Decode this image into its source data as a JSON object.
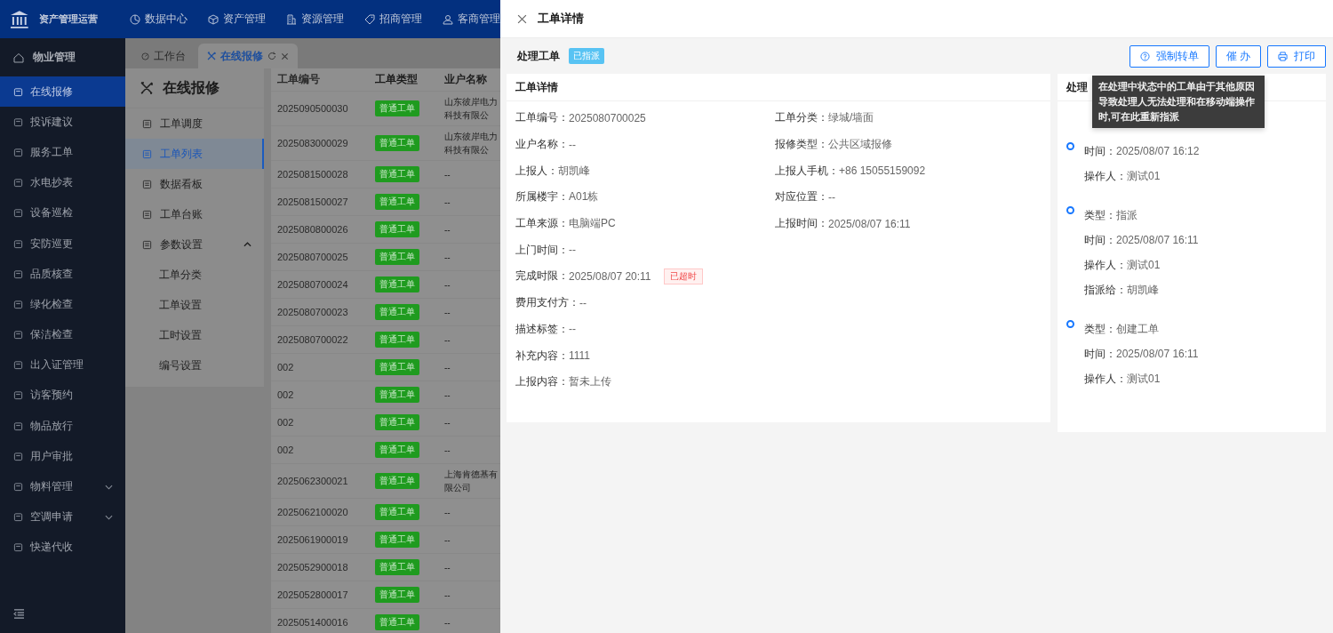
{
  "app": {
    "title": "资产管理运营"
  },
  "top_nav": [
    {
      "label": "数据中心"
    },
    {
      "label": "资产管理"
    },
    {
      "label": "资源管理"
    },
    {
      "label": "招商管理"
    },
    {
      "label": "客商管理"
    }
  ],
  "sidebar": {
    "header": "物业管理",
    "items": [
      {
        "label": "在线报修",
        "selected": true,
        "expandable": false
      },
      {
        "label": "投诉建议",
        "selected": false,
        "expandable": false
      },
      {
        "label": "服务工单",
        "selected": false,
        "expandable": false
      },
      {
        "label": "水电抄表",
        "selected": false,
        "expandable": false
      },
      {
        "label": "设备巡检",
        "selected": false,
        "expandable": false
      },
      {
        "label": "安防巡更",
        "selected": false,
        "expandable": false
      },
      {
        "label": "品质核查",
        "selected": false,
        "expandable": false
      },
      {
        "label": "绿化检查",
        "selected": false,
        "expandable": false
      },
      {
        "label": "保洁检查",
        "selected": false,
        "expandable": false
      },
      {
        "label": "出入证管理",
        "selected": false,
        "expandable": false
      },
      {
        "label": "访客预约",
        "selected": false,
        "expandable": false
      },
      {
        "label": "物品放行",
        "selected": false,
        "expandable": false
      },
      {
        "label": "用户审批",
        "selected": false,
        "expandable": false
      },
      {
        "label": "物料管理",
        "selected": false,
        "expandable": true
      },
      {
        "label": "空调申请",
        "selected": false,
        "expandable": true
      },
      {
        "label": "快递代收",
        "selected": false,
        "expandable": false
      }
    ]
  },
  "tabs": [
    {
      "label": "工作台",
      "selected": false
    },
    {
      "label": "在线报修",
      "selected": true
    }
  ],
  "submenu": {
    "title": "在线报修",
    "items": [
      {
        "label": "工单调度",
        "selected": false
      },
      {
        "label": "工单列表",
        "selected": true
      },
      {
        "label": "数据看板",
        "selected": false
      },
      {
        "label": "工单台账",
        "selected": false
      },
      {
        "label": "参数设置",
        "selected": false,
        "expanded": true,
        "children": [
          {
            "label": "工单分类"
          },
          {
            "label": "工单设置"
          },
          {
            "label": "工时设置"
          },
          {
            "label": "编号设置"
          }
        ]
      }
    ]
  },
  "table": {
    "columns": [
      "工单编号",
      "工单类型",
      "业户名称"
    ],
    "rows": [
      [
        "2025090500030",
        "普通工单",
        "山东彼岸电力科技有限公"
      ],
      [
        "2025083000029",
        "普通工单",
        "山东彼岸电力科技有限公"
      ],
      [
        "2025081500028",
        "普通工单",
        "--"
      ],
      [
        "2025081500027",
        "普通工单",
        "--"
      ],
      [
        "2025080800026",
        "普通工单",
        "--"
      ],
      [
        "2025080700025",
        "普通工单",
        "--"
      ],
      [
        "2025080700024",
        "普通工单",
        "--"
      ],
      [
        "2025080700023",
        "普通工单",
        "--"
      ],
      [
        "2025080700022",
        "普通工单",
        "--"
      ],
      [
        "002",
        "普通工单",
        "--"
      ],
      [
        "002",
        "普通工单",
        "--"
      ],
      [
        "002",
        "普通工单",
        "--"
      ],
      [
        "002",
        "普通工单",
        "--"
      ],
      [
        "2025062300021",
        "普通工单",
        "上海肯德基有限公司"
      ],
      [
        "2025062100020",
        "普通工单",
        "--"
      ],
      [
        "2025061900019",
        "普通工单",
        "--"
      ],
      [
        "2025052900018",
        "普通工单",
        "--"
      ],
      [
        "2025052800017",
        "普通工单",
        "--"
      ],
      [
        "2025051400016",
        "普通工单",
        "--"
      ]
    ]
  },
  "drawer": {
    "title": "工单详情",
    "section": "处理工单",
    "status": "已指派",
    "buttons": [
      {
        "label": "强制转单"
      },
      {
        "label": "催 办"
      },
      {
        "label": "打印"
      }
    ],
    "tooltip": "在处理中状态中的工单由于其他原因导致处理人无法处理和在移动端操作时,可在此重新指派",
    "detail": {
      "title": "工单详情",
      "rows": [
        [
          {
            "label": "工单编号：",
            "value": "2025080700025"
          },
          {
            "label": "工单分类：",
            "value": "绿城/墙面"
          }
        ],
        [
          {
            "label": "业户名称：",
            "value": "--"
          },
          {
            "label": "报修类型：",
            "value": "公共区域报修"
          }
        ],
        [
          {
            "label": "上报人：",
            "value": "胡凯峰"
          },
          {
            "label": "上报人手机：",
            "value": "+86 15055159092"
          }
        ],
        [
          {
            "label": "所属楼宇：",
            "value": "A01栋"
          },
          {
            "label": "对应位置：",
            "value": "--"
          }
        ],
        [
          {
            "label": "工单来源：",
            "value": "电脑端PC"
          },
          {
            "label": "上报时间：",
            "value": "2025/08/07 16:11"
          }
        ],
        [
          {
            "label": "上门时间：",
            "value": "--"
          }
        ],
        [
          {
            "label": "完成时限：",
            "value": "2025/08/07 20:11",
            "tag": "已超时"
          }
        ],
        [
          {
            "label": "费用支付方：",
            "value": "--"
          }
        ],
        [
          {
            "label": "描述标签：",
            "value": "--"
          }
        ],
        [
          {
            "label": "补充内容：",
            "value": "1111"
          }
        ],
        [
          {
            "label": "上报内容：",
            "value": "暂未上传"
          }
        ]
      ]
    },
    "timeline": {
      "title": "处理",
      "entries": [
        [
          {
            "label": "时间：",
            "value": "2025/08/07 16:12"
          },
          {
            "label": "操作人：",
            "value": "测试01"
          }
        ],
        [
          {
            "label": "类型：",
            "value": "指派"
          },
          {
            "label": "时间：",
            "value": "2025/08/07 16:11"
          },
          {
            "label": "操作人：",
            "value": "测试01"
          },
          {
            "label": "指派给：",
            "value": "胡凯峰"
          }
        ],
        [
          {
            "label": "类型：",
            "value": "创建工单"
          },
          {
            "label": "时间：",
            "value": "2025/08/07 16:11"
          },
          {
            "label": "操作人：",
            "value": "测试01"
          }
        ]
      ]
    }
  }
}
